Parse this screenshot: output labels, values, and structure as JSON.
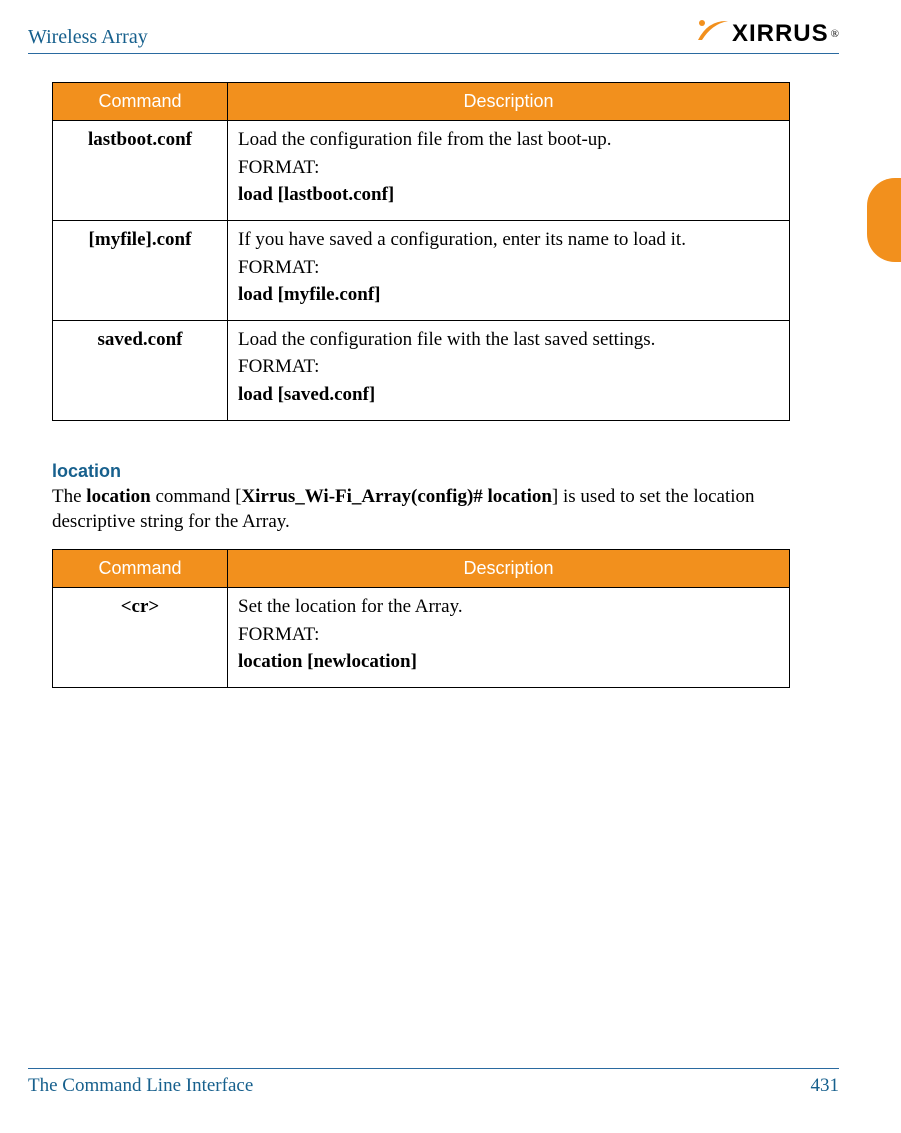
{
  "header": {
    "doc_title": "Wireless Array",
    "brand": "XIRRUS"
  },
  "table1": {
    "col_command": "Command",
    "col_description": "Description",
    "rows": [
      {
        "cmd": "lastboot.conf",
        "desc": "Load the configuration file from the last boot-up.",
        "fmt_label": "FORMAT:",
        "fmt": "load [lastboot.conf]"
      },
      {
        "cmd": "[myfile].conf",
        "desc": "If you have saved a configuration, enter its name to load it.",
        "fmt_label": "FORMAT:",
        "fmt": "load [myfile.conf]"
      },
      {
        "cmd": "saved.conf",
        "desc": "Load the configuration file with the last saved settings.",
        "fmt_label": "FORMAT:",
        "fmt": "load [saved.conf]"
      }
    ]
  },
  "section": {
    "heading": "location",
    "para_pre": "The ",
    "para_b1": "location",
    "para_mid": " command [",
    "para_b2": "Xirrus_Wi-Fi_Array(config)# location",
    "para_post": "] is used to set the location descriptive string for the Array."
  },
  "table2": {
    "col_command": "Command",
    "col_description": "Description",
    "rows": [
      {
        "cmd": "<cr>",
        "desc": "Set the location for the Array.",
        "fmt_label": "FORMAT:",
        "fmt": "location [newlocation]"
      }
    ]
  },
  "footer": {
    "left": "The Command Line Interface",
    "page": "431"
  }
}
